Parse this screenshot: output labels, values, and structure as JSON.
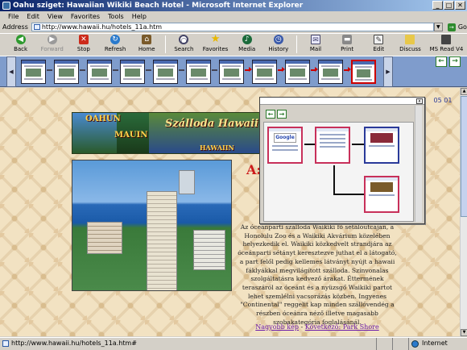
{
  "window": {
    "title": "Oahu sziget: Hawaiian Wikiki Beach Hotel - Microsoft Internet Explorer",
    "controls": [
      "_",
      "□",
      "✕"
    ]
  },
  "menu": [
    "File",
    "Edit",
    "View",
    "Favorites",
    "Tools",
    "Help"
  ],
  "address": {
    "label": "Address",
    "url": "http://www.hawaii.hu/hotels_11a.htm",
    "go_label": "Go",
    "go_arrow": "→"
  },
  "toolbar": {
    "back": "Back",
    "forward": "Forward",
    "stop": "Stop",
    "refresh": "Refresh",
    "home": "Home",
    "search": "Search",
    "favorites": "Favorites",
    "media": "Media",
    "history": "History",
    "mail": "Mail",
    "print": "Print",
    "edit": "Edit",
    "discuss": "Discuss",
    "msread": "MS Read V4"
  },
  "toolbar_glyphs": {
    "back": "◀",
    "forward": "▶",
    "stop": "✕",
    "refresh": "↻",
    "home": "⌂",
    "search": "○",
    "favorites": "★",
    "media": "♪",
    "history": "◷",
    "mail": "✉",
    "print": "▬",
    "edit": "✎",
    "discuss": "",
    "msread": ""
  },
  "history_strip": {
    "scroll_left": "◀",
    "scroll_right": "▶",
    "nav_back": "←",
    "nav_forward": "→",
    "thumbnail_count": 11,
    "selected_index": 10
  },
  "page": {
    "banner": {
      "left": "OAHUN",
      "middle": "MAUIN",
      "right_title": "Szálloda Hawaii",
      "right_sub": "HAWAIIN"
    },
    "heading": "A:",
    "body_text": "Az óceánparti szálloda Waikiki fő sétálóutcáján, a Honolulu Zoo és a Waikiki Akvárium közelében helyezkedik el. Waikiki közkedvelt strandjára az óceánparti sétányt keresztezve juthat el a látogató, a part felől pedig kellemes látványt nyújt a hawaii fáklyákkal megvilágított szálloda. Színvonalas szolgáltatásra kedvező árakat. Éttermének teraszáról az óceánt és a nyüzsgő Waikiki partot lehet szemlélni vacsorázás közben. Ingyenes \"Continental\" reggelit kap minden szállóvendég a részben óceánra néző illetve magasabb szobakategória foglalásánál.",
    "links": {
      "prev": "Nagyobb kép",
      "separator": " - ",
      "next": "Következő: Park Shore"
    }
  },
  "popup": {
    "close": "x",
    "nav_back": "←",
    "nav_forward": "→",
    "google_label": "Google"
  },
  "clock": "05 01",
  "status": {
    "url": "http://www.hawaii.hu/hotels_11a.htm#",
    "zone": "Internet"
  },
  "scrollbar": {
    "up": "▲",
    "down": "▼"
  },
  "colors": {
    "titlebar_start": "#0a246a",
    "strip_bg": "#7f9ccc",
    "page_bg": "#f2e2c2",
    "heading_red": "#cc1a1a",
    "link_purple": "#6a1aa8",
    "popup_node_pink": "#c8305a",
    "popup_node_blue": "#2a3a9a"
  }
}
